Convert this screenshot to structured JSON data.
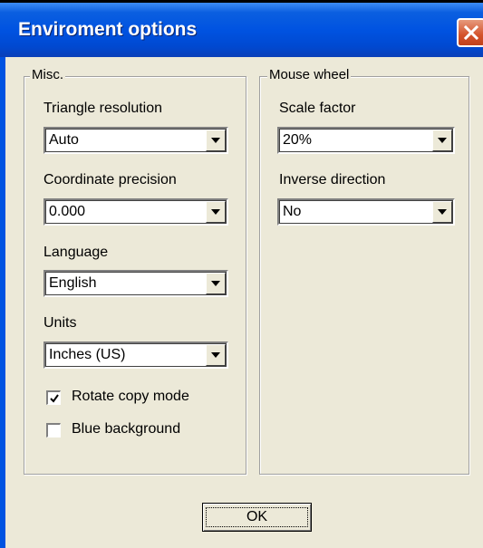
{
  "window": {
    "title": "Enviroment options"
  },
  "misc": {
    "legend": "Misc.",
    "triangle_resolution": {
      "label": "Triangle resolution",
      "value": "Auto"
    },
    "coordinate_precision": {
      "label": "Coordinate precision",
      "value": "0.000"
    },
    "language": {
      "label": "Language",
      "value": "English"
    },
    "units": {
      "label": "Units",
      "value": "Inches (US)"
    },
    "rotate_copy_mode": {
      "label": "Rotate copy mode",
      "checked": true
    },
    "blue_background": {
      "label": "Blue background",
      "checked": false
    }
  },
  "mouse_wheel": {
    "legend": "Mouse wheel",
    "scale_factor": {
      "label": "Scale factor",
      "value": "20%"
    },
    "inverse_direction": {
      "label": "Inverse direction",
      "value": "No"
    }
  },
  "buttons": {
    "ok_label": "OK"
  },
  "icons": {
    "close": "close-icon",
    "dropdown": "dropdown-arrow-icon",
    "check": "checkmark-icon"
  },
  "colors": {
    "dialog_bg": "#ece9d8",
    "titlebar": "#0053e1",
    "close_button": "#d4522a"
  }
}
